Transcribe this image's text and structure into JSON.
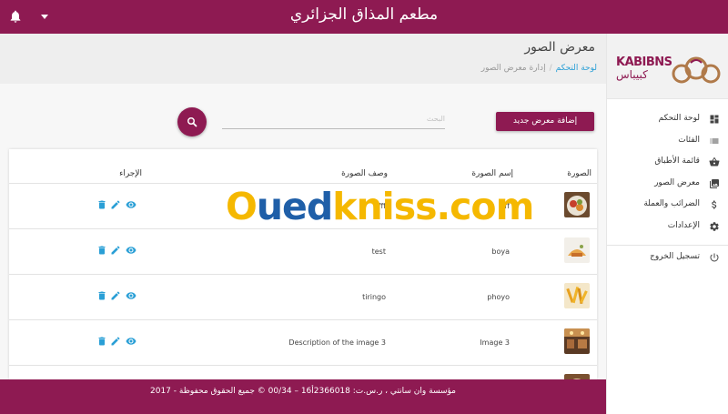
{
  "header": {
    "title": "مطعم المذاق الجزائري",
    "icons": [
      "bell-icon",
      "chevron-down-icon"
    ]
  },
  "page": {
    "title": "معرض الصور",
    "breadcrumb": {
      "home": "لوحة التحكم",
      "current": "إدارة معرض الصور"
    }
  },
  "toolbar": {
    "add_label": "إضافة معرض جديد",
    "search_placeholder": "البحث"
  },
  "table": {
    "columns": {
      "image": "الصورة",
      "name": "إسم الصورة",
      "description": "وصف الصورة",
      "action": "الإجراء"
    },
    "rows": [
      {
        "name": "fff",
        "description": "ffff",
        "thumb": "plate-food"
      },
      {
        "name": "boya",
        "description": "test",
        "thumb": "dish-food"
      },
      {
        "name": "phoyo",
        "description": "tiringo",
        "thumb": "fries"
      },
      {
        "name": "Image 3",
        "description": "Description of the image 3",
        "thumb": "restaurant-interior"
      }
    ]
  },
  "sidebar": {
    "logo_latin": "KABIBNS",
    "logo_arabic": "كبيباس",
    "items": [
      {
        "label": "لوحة التحكم",
        "icon": "dashboard-icon"
      },
      {
        "label": "الفئات",
        "icon": "list-icon"
      },
      {
        "label": "قائمة الأطباق",
        "icon": "basket-icon"
      },
      {
        "label": "معرض الصور",
        "icon": "image-icon"
      },
      {
        "label": "الضرائب والعملة",
        "icon": "dollar-icon"
      },
      {
        "label": "الإعدادات",
        "icon": "gear-icon"
      }
    ],
    "logout": {
      "label": "تسجيل الخروج",
      "icon": "power-icon"
    }
  },
  "footer": {
    "text": "مؤسسة وان سانتي ، ر.س.ت: 2366018أ16 – 00/34 © جميع الحقوق محفوظة - 2017"
  },
  "watermark": {
    "part1": "O",
    "part2": "ued",
    "part3": "kniss.com"
  },
  "colors": {
    "primary": "#8e1a52",
    "icon_blue": "#2a9fd6",
    "page_bg": "#f7f7f7"
  }
}
